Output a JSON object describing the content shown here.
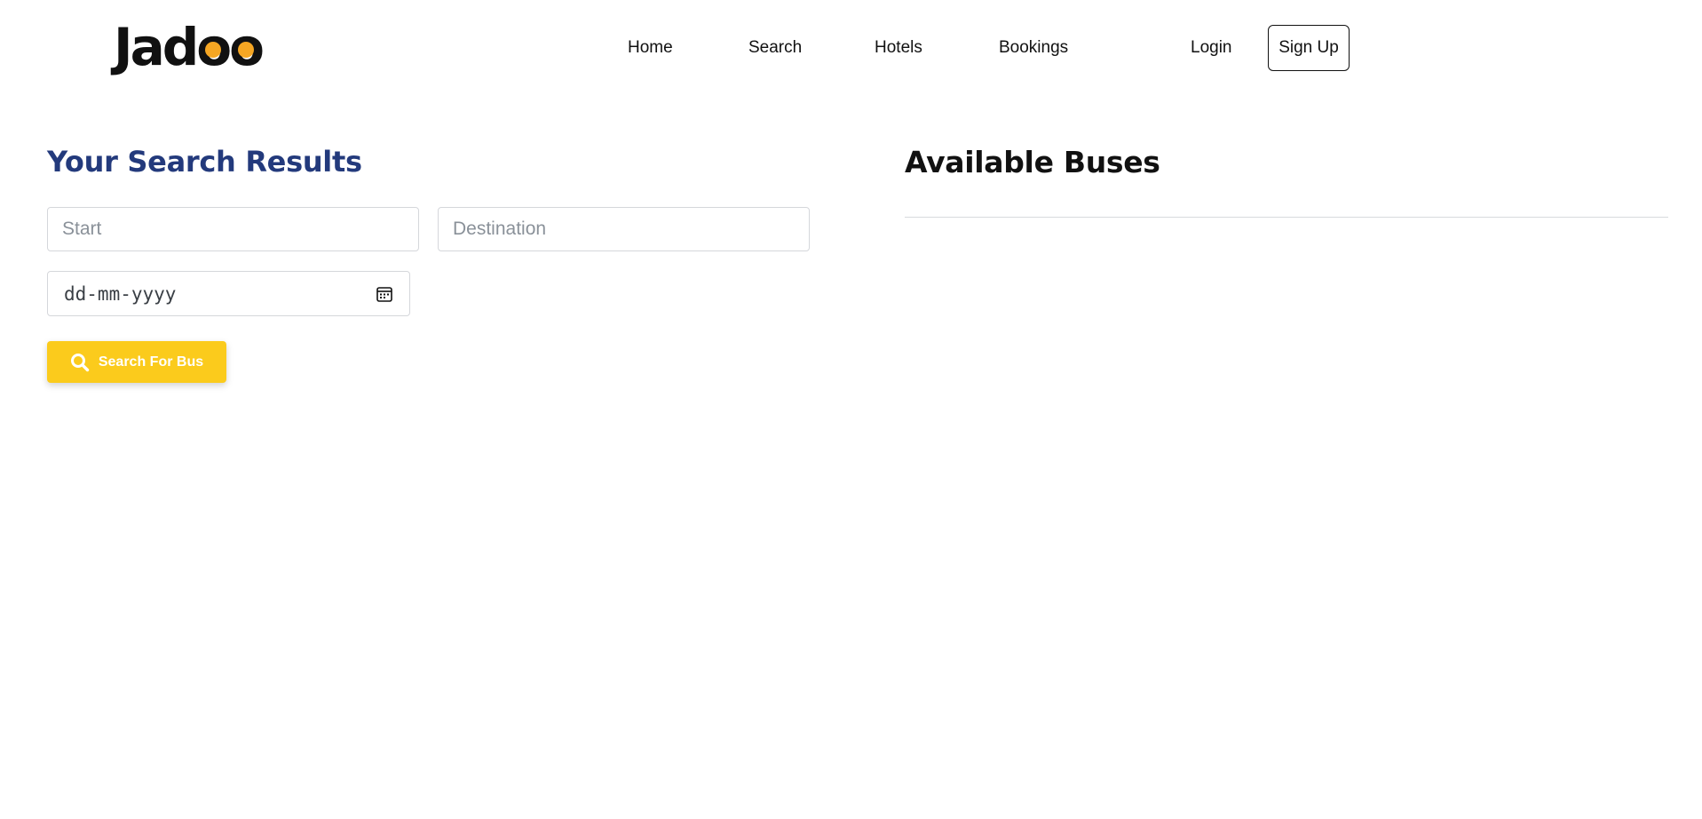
{
  "header": {
    "logo_text": "Jadoo",
    "logo_accent_color": "#f5a623",
    "nav": {
      "home": "Home",
      "search": "Search",
      "hotels": "Hotels",
      "bookings": "Bookings",
      "login": "Login",
      "signup": "Sign Up"
    }
  },
  "search_panel": {
    "title": "Your Search Results",
    "title_color": "#233a7c",
    "start": {
      "placeholder": "Start",
      "value": ""
    },
    "destination": {
      "placeholder": "Destination",
      "value": ""
    },
    "date": {
      "placeholder": "dd-mm-yyyy",
      "icon": "calendar-icon"
    },
    "search_button": {
      "label": "Search For Bus",
      "icon": "search-icon",
      "color": "#fbcb1c"
    }
  },
  "results_panel": {
    "title": "Available Buses",
    "buses": []
  }
}
